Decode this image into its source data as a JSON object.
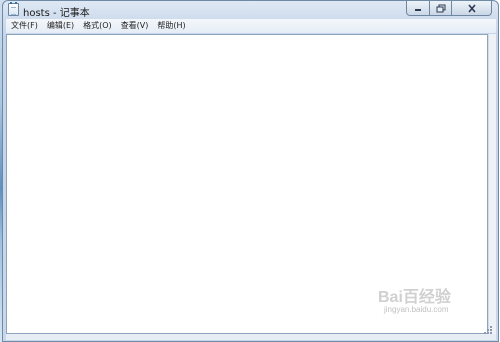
{
  "window": {
    "title": "hosts - 记事本"
  },
  "caption": {
    "minimize_icon": "minimize-icon",
    "maximize_icon": "restore-icon",
    "close_icon": "close-icon"
  },
  "menu": {
    "items": [
      {
        "label": "文件(F)"
      },
      {
        "label": "编辑(E)"
      },
      {
        "label": "格式(O)"
      },
      {
        "label": "查看(V)"
      },
      {
        "label": "帮助(H)"
      }
    ]
  },
  "editor": {
    "content": ""
  },
  "watermark": {
    "brand": "Bai百经验",
    "sub": "jingyan.baidu.com"
  }
}
